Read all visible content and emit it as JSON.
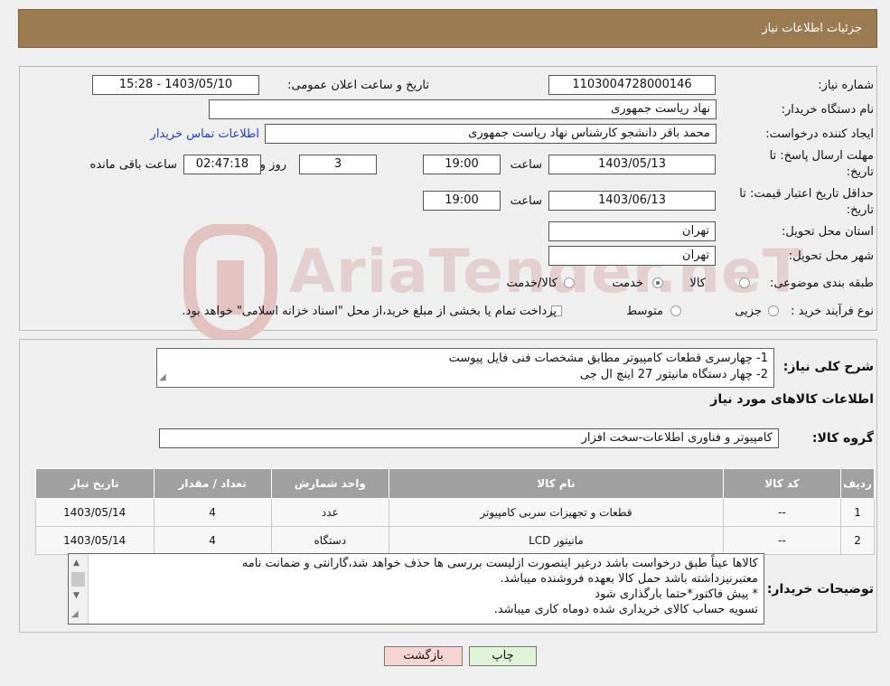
{
  "header": {
    "title": "جزئیات اطلاعات نیاز"
  },
  "watermark": "AriaTender.neT",
  "form": {
    "need_number_label": "شماره نیاز:",
    "need_number": "1103004728000146",
    "announce_label": "تاریخ و ساعت اعلان عمومی:",
    "announce_value": "1403/05/10 - 15:28",
    "buyer_org_label": "نام دستگاه خریدار:",
    "buyer_org": "نهاد ریاست جمهوری",
    "creator_label": "ایجاد کننده درخواست:",
    "creator": "محمد باقر دانشجو کارشناس نهاد ریاست جمهوری",
    "contact_link": "اطلاعات تماس خریدار",
    "deadline_label_1": "مهلت ارسال پاسخ: تا",
    "deadline_label_2": "تاریخ:",
    "deadline_date": "1403/05/13",
    "time_label": "ساعت",
    "deadline_time": "19:00",
    "days_value": "3",
    "days_label": "روز و",
    "remaining_time": "02:47:18",
    "remaining_label": "ساعت باقی مانده",
    "validity_label_1": "حداقل تاریخ اعتبار قیمت: تا",
    "validity_label_2": "تاریخ:",
    "validity_date": "1403/06/13",
    "validity_time": "19:00",
    "province_label": "استان محل تحویل:",
    "province": "تهران",
    "city_label": "شهر محل تحویل:",
    "city": "تهران",
    "category_label": "طبقه بندی موضوعی:",
    "category_options": [
      "کالا",
      "خدمت",
      "کالا/خدمت"
    ],
    "process_label": "نوع فرآیند خرید :",
    "process_options": [
      "جزیی",
      "متوسط"
    ],
    "process_note": "پرداخت تمام یا بخشی از مبلغ خرید،از محل \"اسناد خزانه اسلامی\" خواهد بود."
  },
  "description": {
    "label": "شرح کلی نیاز:",
    "lines": [
      "1- چهارسری قطعات کامپیوتر مطابق مشخصات فنی فایل پیوست",
      "2-  چهار دستگاه مانیتور 27 اینچ ال جی"
    ]
  },
  "goods": {
    "title": "اطلاعات کالاهای مورد نیاز",
    "group_label": "گروه کالا:",
    "group_value": "کامپیوتر و فناوری اطلاعات-سخت افزار",
    "columns": [
      "ردیف",
      "کد کالا",
      "نام کالا",
      "واحد شمارش",
      "تعداد / مقدار",
      "تاریخ نیاز"
    ],
    "rows": [
      [
        "1",
        "--",
        "قطعات و تجهیزات سربی کامپیوتر",
        "عدد",
        "4",
        "1403/05/14"
      ],
      [
        "2",
        "--",
        "مانیتور LCD",
        "دستگاه",
        "4",
        "1403/05/14"
      ]
    ]
  },
  "buyer_notes": {
    "label": "توضیحات خریدار:",
    "lines": [
      "کالاها عیناً طبق درخواست باشد درغیر اینصورت ازلیست بررسی ها حذف خواهد شد،گارانتی و ضمانت نامه",
      "معتبرنیزداشته باشد حمل کالا بعهده فروشنده میباشد.",
      "* پیش فاکتور*حتما بارگذاری شود",
      "تسویه حساب کالای خریداری شده دوماه کاری میباشد."
    ]
  },
  "buttons": {
    "print": "چاپ",
    "back": "بازگشت"
  },
  "colors": {
    "header_bg": "#9b7b52",
    "link": "#1f3ccf",
    "table_header": "#a0a0a0",
    "back_btn": "#f6d4d4",
    "print_btn": "#dff3d6"
  }
}
